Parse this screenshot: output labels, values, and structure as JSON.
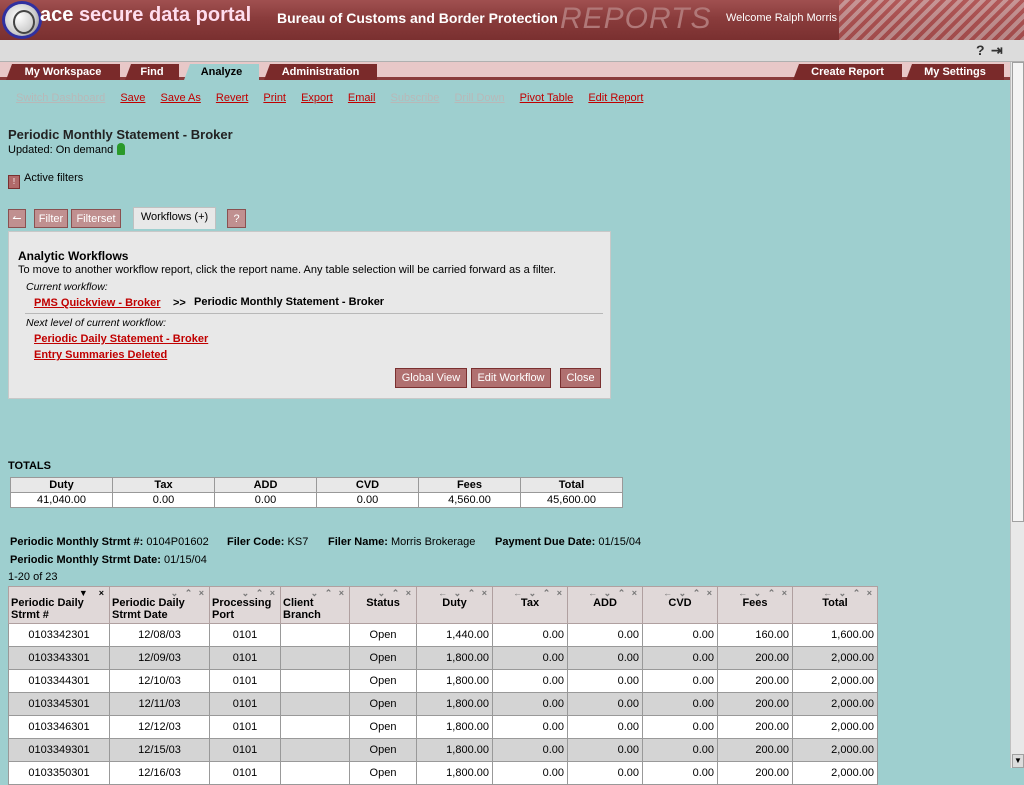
{
  "banner": {
    "brand_ace": "ace",
    "brand_rest": "secure data portal",
    "agency": "Bureau of Customs and Border Protection",
    "section": "REPORTS",
    "welcome": "Welcome Ralph Morris"
  },
  "strip": {
    "help_icon": "?",
    "logout_icon": "⇥"
  },
  "tabs": {
    "left": [
      "My Workspace",
      "Find",
      "Analyze",
      "Administration"
    ],
    "right": [
      "Create Report",
      "My Settings"
    ],
    "active": "Analyze"
  },
  "actions": [
    {
      "label": "Switch Dashboard",
      "enabled": false
    },
    {
      "label": "Save",
      "enabled": true
    },
    {
      "label": "Save As",
      "enabled": true
    },
    {
      "label": "Revert",
      "enabled": true
    },
    {
      "label": "Print",
      "enabled": true
    },
    {
      "label": "Export",
      "enabled": true
    },
    {
      "label": "Email",
      "enabled": true
    },
    {
      "label": "Subscribe",
      "enabled": false
    },
    {
      "label": "Drill Down",
      "enabled": false
    },
    {
      "label": "Pivot Table",
      "enabled": true
    },
    {
      "label": "Edit Report",
      "enabled": true
    }
  ],
  "report": {
    "title": "Periodic Monthly Statement - Broker",
    "updated": "Updated: On demand",
    "active_filters": "Active filters"
  },
  "panel_tabs": {
    "filter": "Filter",
    "filterset": "Filterset",
    "workflows": "Workflows (+)",
    "help": "?"
  },
  "workflow": {
    "heading": "Analytic Workflows",
    "description": "To move to another workflow report, click the report name. Any table selection will be carried forward as a filter.",
    "current_label": "Current workflow:",
    "current_link": "PMS Quickview - Broker",
    "arrow": ">>",
    "current_report": "Periodic Monthly Statement - Broker",
    "next_label": "Next level of current workflow:",
    "next_links": [
      "Periodic Daily Statement - Broker",
      "Entry Summaries Deleted"
    ],
    "buttons": {
      "global": "Global View",
      "edit": "Edit Workflow",
      "close": "Close"
    }
  },
  "totals": {
    "label": "TOTALS",
    "headers": [
      "Duty",
      "Tax",
      "ADD",
      "CVD",
      "Fees",
      "Total"
    ],
    "values": [
      "41,040.00",
      "0.00",
      "0.00",
      "0.00",
      "4,560.00",
      "45,600.00"
    ]
  },
  "statement": {
    "pms_label": "Periodic Monthly Strmt #:",
    "pms_value": "0104P01602",
    "filer_code_label": "Filer Code:",
    "filer_code_value": "KS7",
    "filer_name_label": "Filer Name:",
    "filer_name_value": "Morris Brokerage",
    "due_label": "Payment Due Date:",
    "due_value": "01/15/04",
    "date_label": "Periodic Monthly Strmt Date:",
    "date_value": "01/15/04",
    "range": "1-20 of 23"
  },
  "table": {
    "columns": [
      "Periodic Daily Strmt #",
      "Periodic Daily Strmt Date",
      "Processing Port",
      "Client Branch",
      "Status",
      "Duty",
      "Tax",
      "ADD",
      "CVD",
      "Fees",
      "Total"
    ],
    "rows": [
      [
        "0103342301",
        "12/08/03",
        "0101",
        "",
        "Open",
        "1,440.00",
        "0.00",
        "0.00",
        "0.00",
        "160.00",
        "1,600.00"
      ],
      [
        "0103343301",
        "12/09/03",
        "0101",
        "",
        "Open",
        "1,800.00",
        "0.00",
        "0.00",
        "0.00",
        "200.00",
        "2,000.00"
      ],
      [
        "0103344301",
        "12/10/03",
        "0101",
        "",
        "Open",
        "1,800.00",
        "0.00",
        "0.00",
        "0.00",
        "200.00",
        "2,000.00"
      ],
      [
        "0103345301",
        "12/11/03",
        "0101",
        "",
        "Open",
        "1,800.00",
        "0.00",
        "0.00",
        "0.00",
        "200.00",
        "2,000.00"
      ],
      [
        "0103346301",
        "12/12/03",
        "0101",
        "",
        "Open",
        "1,800.00",
        "0.00",
        "0.00",
        "0.00",
        "200.00",
        "2,000.00"
      ],
      [
        "0103349301",
        "12/15/03",
        "0101",
        "",
        "Open",
        "1,800.00",
        "0.00",
        "0.00",
        "0.00",
        "200.00",
        "2,000.00"
      ],
      [
        "0103350301",
        "12/16/03",
        "0101",
        "",
        "Open",
        "1,800.00",
        "0.00",
        "0.00",
        "0.00",
        "200.00",
        "2,000.00"
      ]
    ]
  },
  "colors": {
    "banner": "#8a3c3c",
    "background": "#9ecfcf",
    "link": "#c00000",
    "button": "#b07070"
  }
}
